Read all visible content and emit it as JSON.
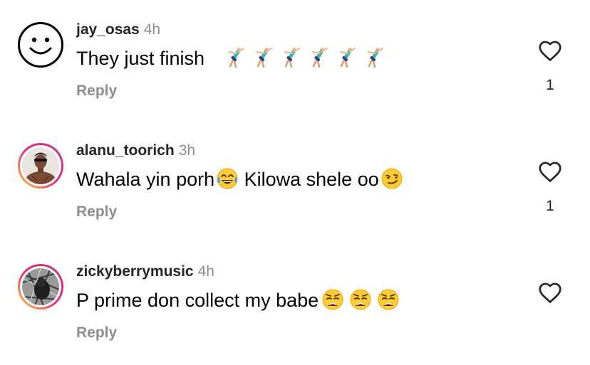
{
  "comments": [
    {
      "username": "jay_osas",
      "time": "4h",
      "text": "They just finish",
      "emojis": [
        "cartwheel",
        "cartwheel",
        "cartwheel",
        "cartwheel",
        "cartwheel",
        "cartwheel"
      ],
      "reply_label": "Reply",
      "likes": "1",
      "avatar": "smiley-face-icon"
    },
    {
      "username": "alanu_toorich",
      "time": "3h",
      "text_before": "Wahala yin porh",
      "emoji_mid": "face-with-tears-of-joy",
      "text_after": " Kilowa shele oo",
      "emoji_end": "smirking-face",
      "reply_label": "Reply",
      "likes": "1",
      "avatar": "profile-photo"
    },
    {
      "username": "zickyberrymusic",
      "time": "4h",
      "text": "P prime don collect my babe",
      "emojis": [
        "weary-face",
        "weary-face",
        "weary-face"
      ],
      "reply_label": "Reply",
      "likes": "",
      "avatar": "profile-photo"
    }
  ],
  "icons": {
    "like": "heart-outline-icon"
  },
  "colors": {
    "muted": "#8e8e8e",
    "story_ring_start": "#f9ce34",
    "story_ring_end": "#c13584"
  }
}
